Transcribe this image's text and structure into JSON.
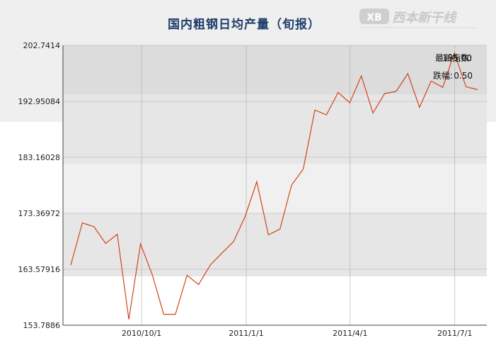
{
  "title": "国内粗钢日均产量（旬报）",
  "logo_text": "西本新干线",
  "info": {
    "latest_label": "最新指数:",
    "latest_value": "195.00",
    "change_label": "跌幅:",
    "change_value": "0.50"
  },
  "colors": {
    "line": "#d2461b",
    "band_dark": "#dcdcdc",
    "band_mid": "#e6e6e6",
    "band_light": "#f0f0f0",
    "grid": "#aaaaaa",
    "title": "#1f3d6b"
  },
  "chart_data": {
    "type": "line",
    "title": "国内粗钢日均产量（旬报）",
    "ylim": [
      153.7886,
      202.7414
    ],
    "yticks": [
      "153.7886",
      "163.57916",
      "173.36972",
      "183.16028",
      "192.95084",
      "202.7414"
    ],
    "xticks": [
      "2010/10/1",
      "2011/1/1",
      "2011/4/1",
      "2011/7/1"
    ],
    "grid": true,
    "series": [
      {
        "values": [
          164.3,
          171.7,
          171.0,
          168.1,
          169.7,
          154.8,
          168.0,
          162.7,
          155.7,
          155.7,
          162.5,
          160.9,
          164.3,
          166.4,
          168.4,
          172.8,
          178.9,
          169.6,
          170.6,
          178.3,
          181.1,
          191.4,
          190.6,
          194.5,
          192.7,
          197.4,
          190.9,
          194.3,
          194.7,
          197.8,
          191.9,
          196.5,
          195.4,
          201.4,
          195.5,
          195.0
        ]
      }
    ]
  }
}
